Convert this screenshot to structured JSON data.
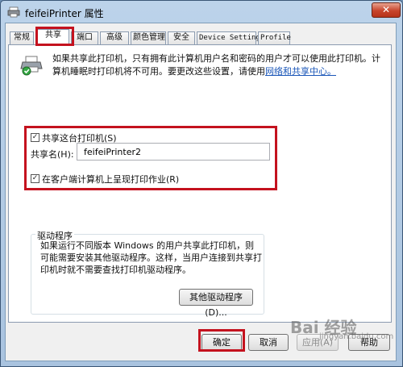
{
  "window": {
    "title": "feifeiPrinter 属性",
    "close_label": "✕"
  },
  "tabs": [
    {
      "label": "常规"
    },
    {
      "label": "共享"
    },
    {
      "label": "端口"
    },
    {
      "label": "高级"
    },
    {
      "label": "颜色管理"
    },
    {
      "label": "安全"
    },
    {
      "label": "Device Settings"
    },
    {
      "label": "Profile"
    }
  ],
  "info": {
    "text": "如果共享此打印机，只有拥有此计算机用户名和密码的用户才可以使用此打印机。计算机睡眠时打印机将不可用。要更改这些设置，请使用",
    "link": "网络和共享中心。"
  },
  "share": {
    "checkbox_label": "共享这台打印机(S)",
    "checked": true,
    "name_label": "共享名(H):",
    "name_value": "feifeiPrinter2",
    "render_label": "在客户端计算机上呈现打印作业(R)",
    "render_checked": true
  },
  "drivers": {
    "title": "驱动程序",
    "text": "如果运行不同版本 Windows 的用户共享此打印机，则可能需要安装其他驱动程序。这样，当用户连接到共享打印机时就不需要查找打印机驱动程序。",
    "button": "其他驱动程序(D)..."
  },
  "footer": {
    "ok": "确定",
    "cancel": "取消",
    "apply": "应用(A)",
    "help": "帮助"
  },
  "watermark": {
    "text": "Bai 经验",
    "sub": "jingyan.baidu.com"
  },
  "colors": {
    "highlight": "#c4121e",
    "link": "#1a56b8",
    "titlebar": "#bcd3ea"
  },
  "icons": [
    "printer-icon",
    "close-icon",
    "checkbox-check-icon"
  ]
}
